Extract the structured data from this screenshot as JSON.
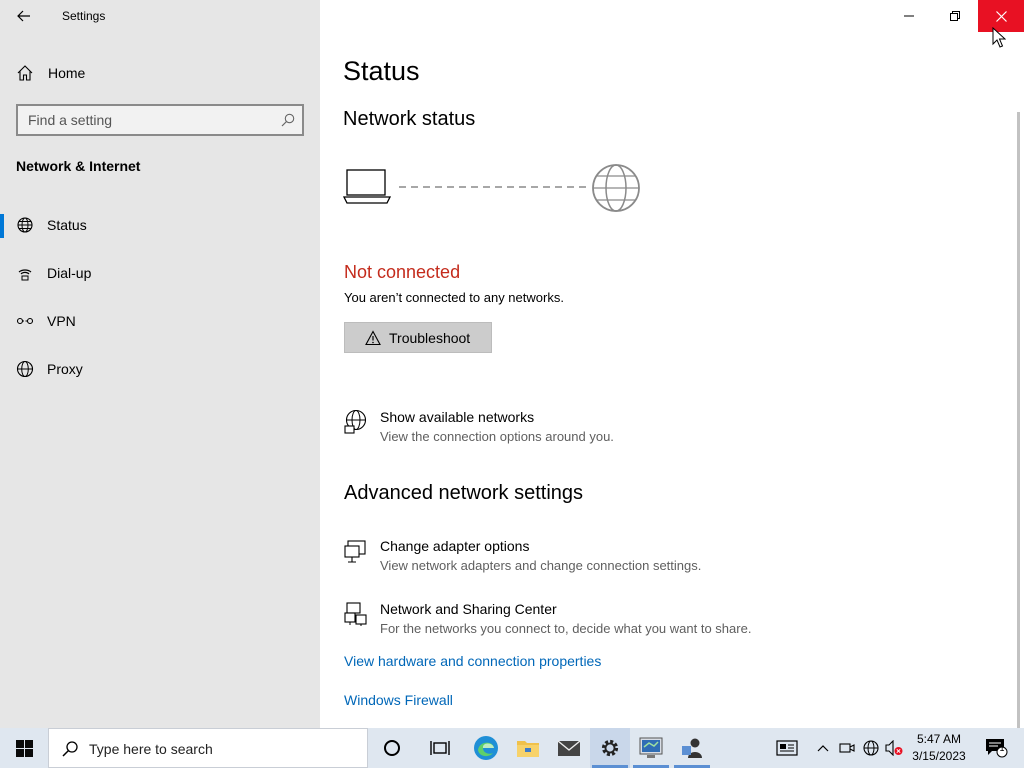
{
  "window": {
    "title": "Settings",
    "controls": {
      "minimize": "minimize",
      "restore": "restore",
      "close": "close"
    }
  },
  "sidebar": {
    "home_label": "Home",
    "search_placeholder": "Find a setting",
    "section_title": "Network & Internet",
    "items": [
      {
        "label": "Status",
        "icon": "globe-network-icon",
        "active": true
      },
      {
        "label": "Dial-up",
        "icon": "dialup-icon",
        "active": false
      },
      {
        "label": "VPN",
        "icon": "vpn-icon",
        "active": false
      },
      {
        "label": "Proxy",
        "icon": "globe-icon",
        "active": false
      }
    ]
  },
  "main": {
    "title": "Status",
    "network_status_heading": "Network status",
    "connection_state": "Not connected",
    "connection_desc": "You aren’t connected to any networks.",
    "troubleshoot_label": "Troubleshoot",
    "show_networks": {
      "title": "Show available networks",
      "desc": "View the connection options around you."
    },
    "advanced_heading": "Advanced network settings",
    "change_adapter": {
      "title": "Change adapter options",
      "desc": "View network adapters and change connection settings."
    },
    "sharing_center": {
      "title": "Network and Sharing Center",
      "desc": "For the networks you connect to, decide what you want to share."
    },
    "links": {
      "hardware": "View hardware and connection properties",
      "firewall": "Windows Firewall"
    }
  },
  "taskbar": {
    "search_placeholder": "Type here to search",
    "clock_time": "5:47 AM",
    "clock_date": "3/15/2023",
    "notification_count": "1"
  },
  "colors": {
    "accent": "#0078d7",
    "error": "#c42b1c",
    "link": "#0067b8",
    "close_button": "#e81123",
    "sidebar_bg": "#e6e6e6"
  }
}
